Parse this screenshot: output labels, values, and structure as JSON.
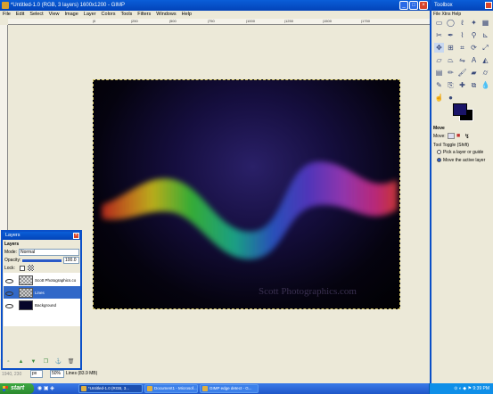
{
  "window": {
    "title": "*Untitled-1.0 (RGB, 3 layers) 1600x1200 - GIMP"
  },
  "menu": [
    "File",
    "Edit",
    "Select",
    "View",
    "Image",
    "Layer",
    "Colors",
    "Tools",
    "Filters",
    "Windows",
    "Help"
  ],
  "ruler_top": [
    "|0",
    "|250",
    "|500",
    "|750",
    "|1000",
    "|1250",
    "|1500",
    "|1750"
  ],
  "image": {
    "watermark": "Scott Photographics.com"
  },
  "statusbar": {
    "coords": "1940, 230",
    "unit": "px",
    "zoom": "50%",
    "message": "Lines (83.9 MB)"
  },
  "layers": {
    "title": "Layers",
    "header": "Layers",
    "mode_label": "Mode:",
    "mode_value": "Normal",
    "opacity_label": "Opacity:",
    "opacity_value": "100.0",
    "lock_label": "Lock:",
    "items": [
      {
        "name": "Scott Photographics.co"
      },
      {
        "name": "Lines"
      },
      {
        "name": "Background"
      }
    ]
  },
  "toolbox": {
    "title": "Toolbox",
    "menu": "File  Xtns  Help",
    "options_title": "Move",
    "move_label": "Move:",
    "toggle_label": "Tool Toggle  (Shift)",
    "option1": "Pick a layer or guide",
    "option2": "Move the active layer",
    "fg_color": "#1a1468",
    "bg_color": "#000000"
  },
  "taskbar": {
    "start": "start",
    "tasks": [
      "*Untitled-1.0 (RGB, 3...",
      "Document1 - Microsof...",
      "GIMP edge detect - G..."
    ],
    "clock": "9:39 PM"
  }
}
